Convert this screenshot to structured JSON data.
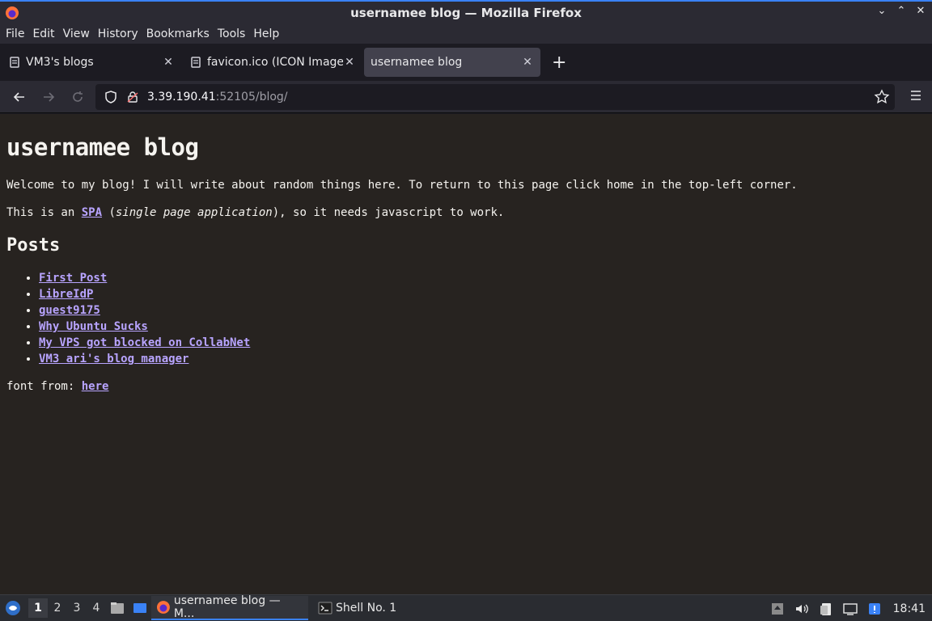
{
  "window": {
    "title": "usernamee blog — Mozilla Firefox",
    "controls": [
      "⌄",
      "⌃",
      "✕"
    ]
  },
  "menubar": [
    "File",
    "Edit",
    "View",
    "History",
    "Bookmarks",
    "Tools",
    "Help"
  ],
  "tabs": [
    {
      "label": "VM3's blogs",
      "icon": "page-icon",
      "active": false
    },
    {
      "label": "favicon.ico (ICON Image,",
      "icon": "page-icon",
      "active": false
    },
    {
      "label": "usernamee blog",
      "icon": null,
      "active": true
    }
  ],
  "nav": {
    "url_host": "3.39.190.41",
    "url_rest": ":52105/blog/"
  },
  "page": {
    "title": "usernamee blog",
    "intro": "Welcome to my blog! I will write about random things here. To return to this page click home in the top-left corner.",
    "spa_prefix": "This is an ",
    "spa_link": "SPA",
    "spa_open": " (",
    "spa_em": "single page application",
    "spa_suffix": "), so it needs javascript to work.",
    "posts_heading": "Posts",
    "posts": [
      "First Post",
      "LibreIdP",
      "guest9175",
      "Why Ubuntu Sucks",
      "My VPS got blocked on CollabNet",
      "VM3 ari's blog manager"
    ],
    "font_prefix": "font from: ",
    "font_link": "here"
  },
  "taskbar": {
    "workspaces": [
      "1",
      "2",
      "3",
      "4"
    ],
    "active_workspace": "1",
    "tasks": [
      {
        "label": "usernamee blog — M...",
        "active": true
      },
      {
        "label": "Shell No. 1",
        "active": false
      }
    ],
    "clock": "18:41"
  },
  "colors": {
    "link": "#b8a4ff",
    "page_bg": "#272320",
    "accent": "#3a82f6"
  }
}
